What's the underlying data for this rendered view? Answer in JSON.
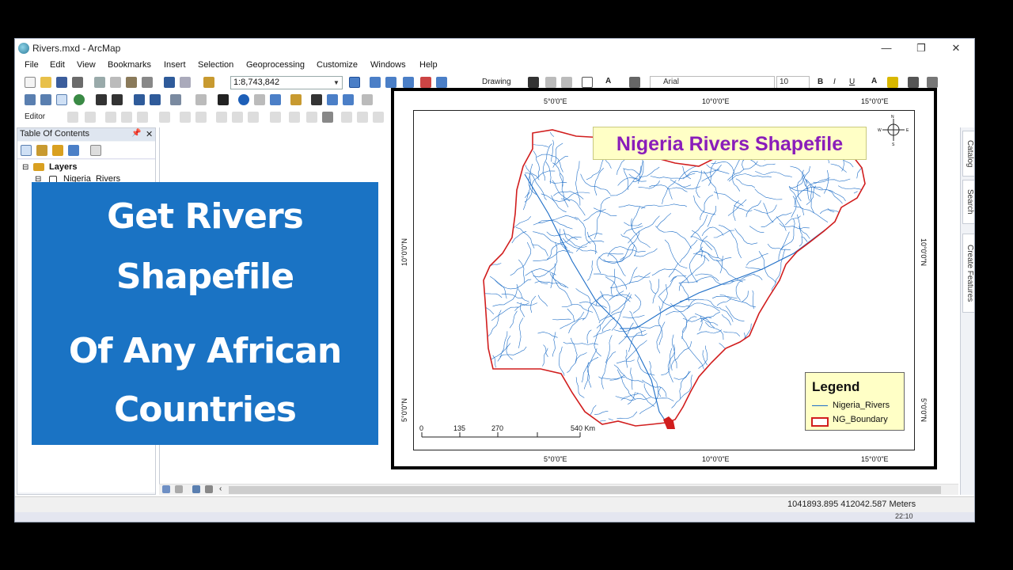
{
  "window": {
    "title": "Rivers.mxd - ArcMap",
    "minimize": "—",
    "maximize": "❐",
    "close": "✕"
  },
  "menu": [
    "File",
    "Edit",
    "View",
    "Bookmarks",
    "Insert",
    "Selection",
    "Geoprocessing",
    "Customize",
    "Windows",
    "Help"
  ],
  "toolbar": {
    "scale": "1:8,743,842",
    "drawing_label": "Drawing",
    "font_name": "Arial",
    "font_size": "10",
    "editor_label": "Editor"
  },
  "toc": {
    "title": "Table Of Contents",
    "pin": "📌",
    "close": "✕",
    "layers_label": "Layers",
    "layer_name": "Nigeria_Rivers"
  },
  "right_dock": {
    "tabs": [
      "Catalog",
      "Search",
      "Create Features"
    ]
  },
  "status": {
    "coordinates": "1041893.895  412042.587 Meters",
    "clock": "22:10"
  },
  "banner": {
    "line1": "Get Rivers",
    "line2": "Shapefile",
    "line3": "Of Any African",
    "line4": "Countries"
  },
  "map": {
    "title": "Nigeria Rivers Shapefile",
    "graticule_top": [
      "5°0'0\"E",
      "10°0'0\"E",
      "15°0'0\"E"
    ],
    "graticule_bottom": [
      "5°0'0\"E",
      "10°0'0\"E",
      "15°0'0\"E"
    ],
    "graticule_left": [
      "10°0'0\"N",
      "5°0'0\"N"
    ],
    "graticule_right": [
      "10°0'0\"N",
      "5°0'0\"N"
    ],
    "scalebar": [
      "0",
      "135",
      "270",
      "540 Km"
    ],
    "north_arrow": {
      "N": "N",
      "S": "S",
      "E": "E",
      "W": "W"
    },
    "colors": {
      "rivers": "#1e6ec7",
      "boundary": "#d11d1d"
    }
  },
  "legend": {
    "title": "Legend",
    "items": [
      "Nigeria_Rivers",
      "NG_Boundary"
    ]
  }
}
